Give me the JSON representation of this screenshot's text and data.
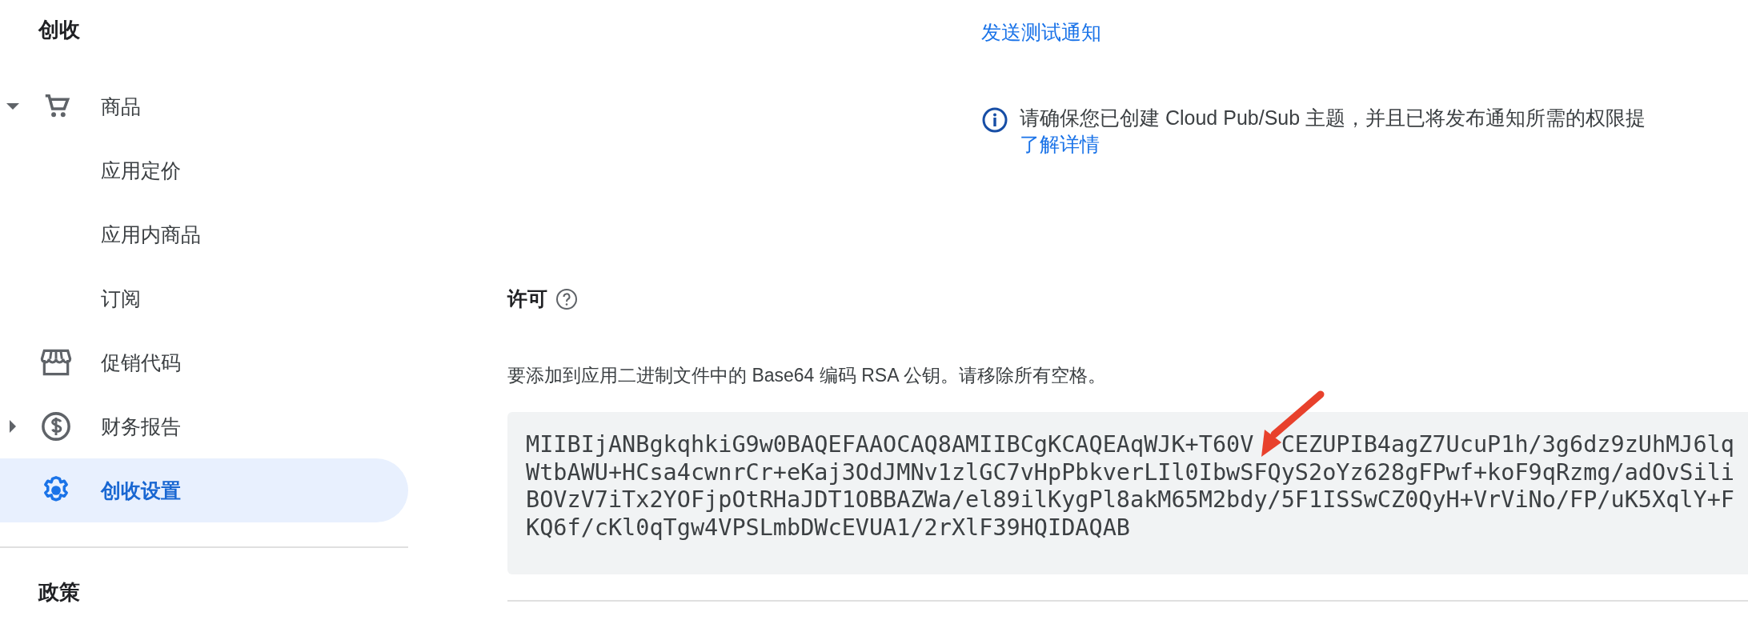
{
  "sidebar": {
    "section_title": "创收",
    "items": [
      {
        "label": "商品",
        "expanded": true,
        "selected": false,
        "children": [
          {
            "label": "应用定价",
            "selected": false
          },
          {
            "label": "应用内商品",
            "selected": false
          },
          {
            "label": "订阅",
            "selected": false
          }
        ]
      },
      {
        "label": "促销代码",
        "selected": false
      },
      {
        "label": "财务报告",
        "expanded": false,
        "selected": false
      },
      {
        "label": "创收设置",
        "selected": true
      }
    ],
    "footer_title": "政策"
  },
  "main": {
    "test_link": "发送测试通知",
    "notice": {
      "text": "请确保您已创建 Cloud Pub/Sub 主题，并且已将发布通知所需的权限提",
      "link": "了解详情"
    },
    "license": {
      "title": "许可",
      "description": "要添加到应用二进制文件中的 Base64 编码 RSA 公钥。请移除所有空格。",
      "key_lines": [
        [
          "MIIBIjANBgkqhkiG9w0BAQEFAAOCAQ8AMIIBCgKCAQEAqWJK+T60V",
          "CEZUPIB4agZ7UcuP1h/3g6dz9zUhMJ6lq"
        ],
        [
          "WtbAWU+HCsa4cwnrCr+eKaj3OdJMNv1zlGC7vHpPbkverLIl0IbwSFQyS2oYz628gFPwf+koF9qRzmg/adOvSili"
        ],
        [
          "BOVzV7iTx2YOFjpOtRHaJDT1OBBAZWa/el89ilKygPl8akM65M2bdy/5F1ISSwCZ0QyH+VrViNo/FP/uK5XqlY+F"
        ],
        [
          "KQ6f/cKl0qTgw4VPSLmbDWcEVUA1/2rXlF39HQIDAQAB"
        ]
      ]
    }
  }
}
